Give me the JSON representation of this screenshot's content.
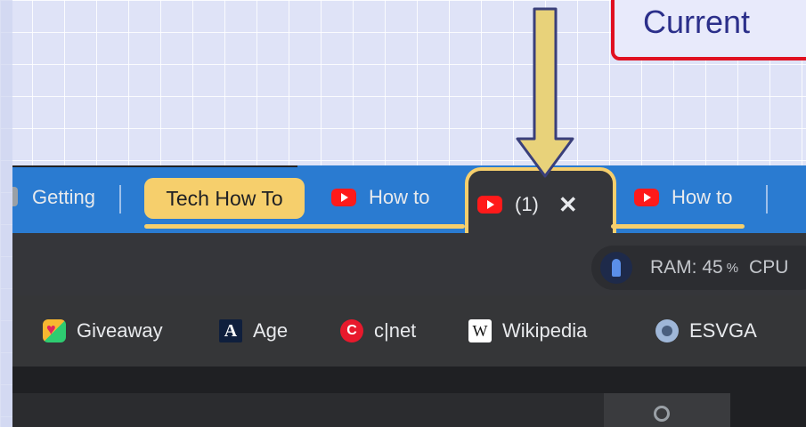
{
  "callout": {
    "text": "Current"
  },
  "tabs": {
    "tab1_label": "Getting",
    "group_label": "Tech How To",
    "tab2_label": "How to",
    "active_label": "(1)",
    "active_close": "✕",
    "tab4_label": "How to"
  },
  "toolbar": {
    "ram_label": "RAM: 45",
    "ram_percent": "%",
    "cpu_label": "CPU"
  },
  "bookmarks": [
    {
      "label": "Giveaway",
      "icon": "giveaway-icon"
    },
    {
      "label": "Age",
      "icon": "age-icon",
      "glyph": "A"
    },
    {
      "label": "c|net",
      "icon": "cnet-icon",
      "glyph": "C"
    },
    {
      "label": "Wikipedia",
      "icon": "wikipedia-icon",
      "glyph": "W"
    },
    {
      "label": "ESVGA",
      "icon": "esvga-icon"
    }
  ],
  "colors": {
    "tabstrip": "#2a7bd1",
    "group_yellow": "#f6cf6c",
    "youtube_red": "#ff1a1a",
    "callout_border": "#e01020",
    "callout_text": "#2b2f8a"
  }
}
